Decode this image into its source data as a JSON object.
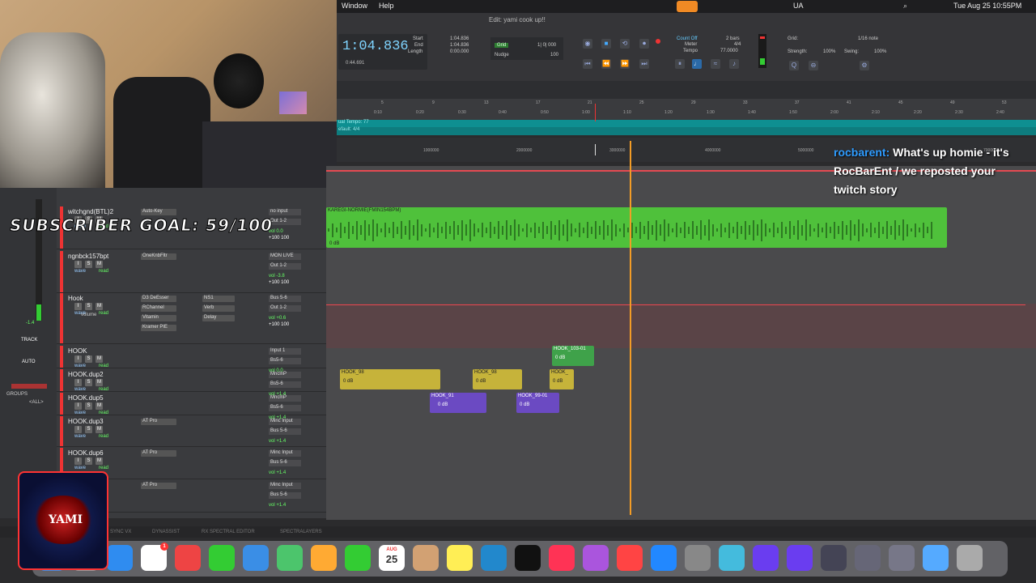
{
  "menubar": {
    "window": "Window",
    "help": "Help",
    "ua": "UA",
    "datetime": "Tue Aug 25  10:55PM"
  },
  "edit_window": {
    "title": "Edit: yami cook up!!"
  },
  "transport": {
    "counter": "1:04.836",
    "start_label": "Start",
    "end_label": "End",
    "length_label": "Length",
    "start_val": "1:04.836",
    "end_val": "1:04.836",
    "length_val": "0:00.000",
    "sub_counter": "0:44.691",
    "nudge": "Nudge",
    "count_off": "Count Off",
    "meter_label": "Meter",
    "tempo_label": "Tempo",
    "bars": "2 bars",
    "meter": "4/4",
    "tempo": "77.0000",
    "grid_label": "Grid:",
    "grid_value": "1/16 note",
    "strength_label": "Strength:",
    "strength": "100%",
    "swing_label": "Swing:",
    "swing": "100%",
    "grid_nudge": "1| 0| 000",
    "nudge_val": "100"
  },
  "rulers": {
    "tempo": "ual Tempo",
    "tempo_val": "77",
    "meter": "efault: 4/4",
    "minsecs": [
      "0:10",
      "0:20",
      "0:30",
      "0:40",
      "0:50",
      "1:00",
      "1:10",
      "1:20",
      "1:30",
      "1:40",
      "1:50",
      "2:00",
      "2:10",
      "2:20",
      "2:30",
      "2:40"
    ],
    "bars": [
      "5",
      "9",
      "13",
      "17",
      "21",
      "25",
      "29",
      "33",
      "37",
      "41",
      "45",
      "49",
      "53"
    ],
    "samples": [
      "1000000",
      "2000000",
      "3000000",
      "4000000",
      "5000000",
      "7000000"
    ]
  },
  "tracks": [
    {
      "name": "witchgnd(BTL)2",
      "insert": "Auto-Key",
      "io_in": "no input",
      "io_out": "Out 1-2",
      "vol": "0.0",
      "pan": "+100  100"
    },
    {
      "name": "ngnbck157bpt",
      "insert": "OneKnbFltr",
      "io_in": "MON LIVE",
      "io_out": "Out 1-2",
      "vol": "-3.8",
      "pan": "+100  100"
    },
    {
      "name": "Hook",
      "insert": "D3 DeEsser",
      "insert2": "RChannel",
      "insert3": "Vitamin",
      "insert4": "Kramer PIE",
      "send1": "NS1",
      "send2": "Verb",
      "send3": "Delay",
      "io_in": "Bus 5-6",
      "io_out": "Out 1-2",
      "vol": "+0.6",
      "pan": "+100  100",
      "sub": "volume"
    },
    {
      "name": "HOOK",
      "io_in": "Input 1",
      "io_out": "Bs5-6",
      "vol": "0.0"
    },
    {
      "name": "HOOK.dup2",
      "io_in": "MnclnP",
      "io_out": "Bs5-6",
      "vol": "+1.4"
    },
    {
      "name": "HOOK.dup5",
      "io_in": "MnclnP",
      "io_out": "Bs5-6",
      "vol": "+1.4"
    },
    {
      "name": "HOOK.dup3",
      "insert": "AT Pro",
      "io_in": "Minc Input",
      "io_out": "Bus 5-6",
      "vol": "+1.4"
    },
    {
      "name": "HOOK.dup6",
      "insert": "AT Pro",
      "io_in": "Minc Input",
      "io_out": "Bus 5-6",
      "vol": "+1.4"
    },
    {
      "name": "HOOK.dup4",
      "insert": "AT Pro",
      "io_in": "Minc Input",
      "io_out": "Bus 5-6",
      "vol": "+1.4"
    }
  ],
  "track_buttons": {
    "i": "I",
    "s": "S",
    "m": "M",
    "wave": "wave",
    "read": "read"
  },
  "left_panel": {
    "track": "TRACK",
    "auto": "AUTO",
    "groups": "GROUPS",
    "all": "<ALL>",
    "level": "-1.4"
  },
  "clips": {
    "beat": "KAREGI-NORMIE(FMIN154BPM)",
    "beat_db": "0 dB",
    "hook_103": "HOOK_103-01",
    "hook_98a": "HOOK_98",
    "hook_98b": "HOOK_98",
    "hook_small": "HOOK_",
    "hook_91a": "HOOK_91",
    "hook_91b": "HOOK_99-01",
    "db": "0 dB"
  },
  "overlays": {
    "subscriber_goal": "SUBSCRIBER GOAL: 59/100",
    "chat_user": "rocbarent:",
    "chat_message": "What's up homie - it's RocBarEnt / we reposted your twitch story",
    "logo_text": "YAMI"
  },
  "bottom_bar": [
    "SYNC VX",
    "DYNASSIST",
    "RX SPECTRAL EDITOR",
    "SPECTRALAYERS"
  ],
  "dock": {
    "apps": [
      "Finder",
      "Launchpad",
      "Safari",
      "Reminders",
      "Chrome",
      "Messages",
      "Mail",
      "Maps",
      "Photos",
      "FaceTime",
      "Calendar",
      "Contacts",
      "Notes",
      "Freeform",
      "TV",
      "Music",
      "Podcasts",
      "News",
      "App Store",
      "System Settings",
      "Preview",
      "Pro Tools",
      "Pro Tools",
      "Avid",
      "Avid",
      "Avid",
      "Files",
      "Trash"
    ],
    "calendar_month": "AUG",
    "calendar_day": "25",
    "badge": "1"
  },
  "colors": {
    "beat_clip": "#4fc13b",
    "hook_clip": "#c6b33a",
    "purple_clip": "#6b4ac2",
    "playhead": "#f29c26",
    "chat_user": "#2e9cff",
    "counter": "#7fd4ff"
  }
}
